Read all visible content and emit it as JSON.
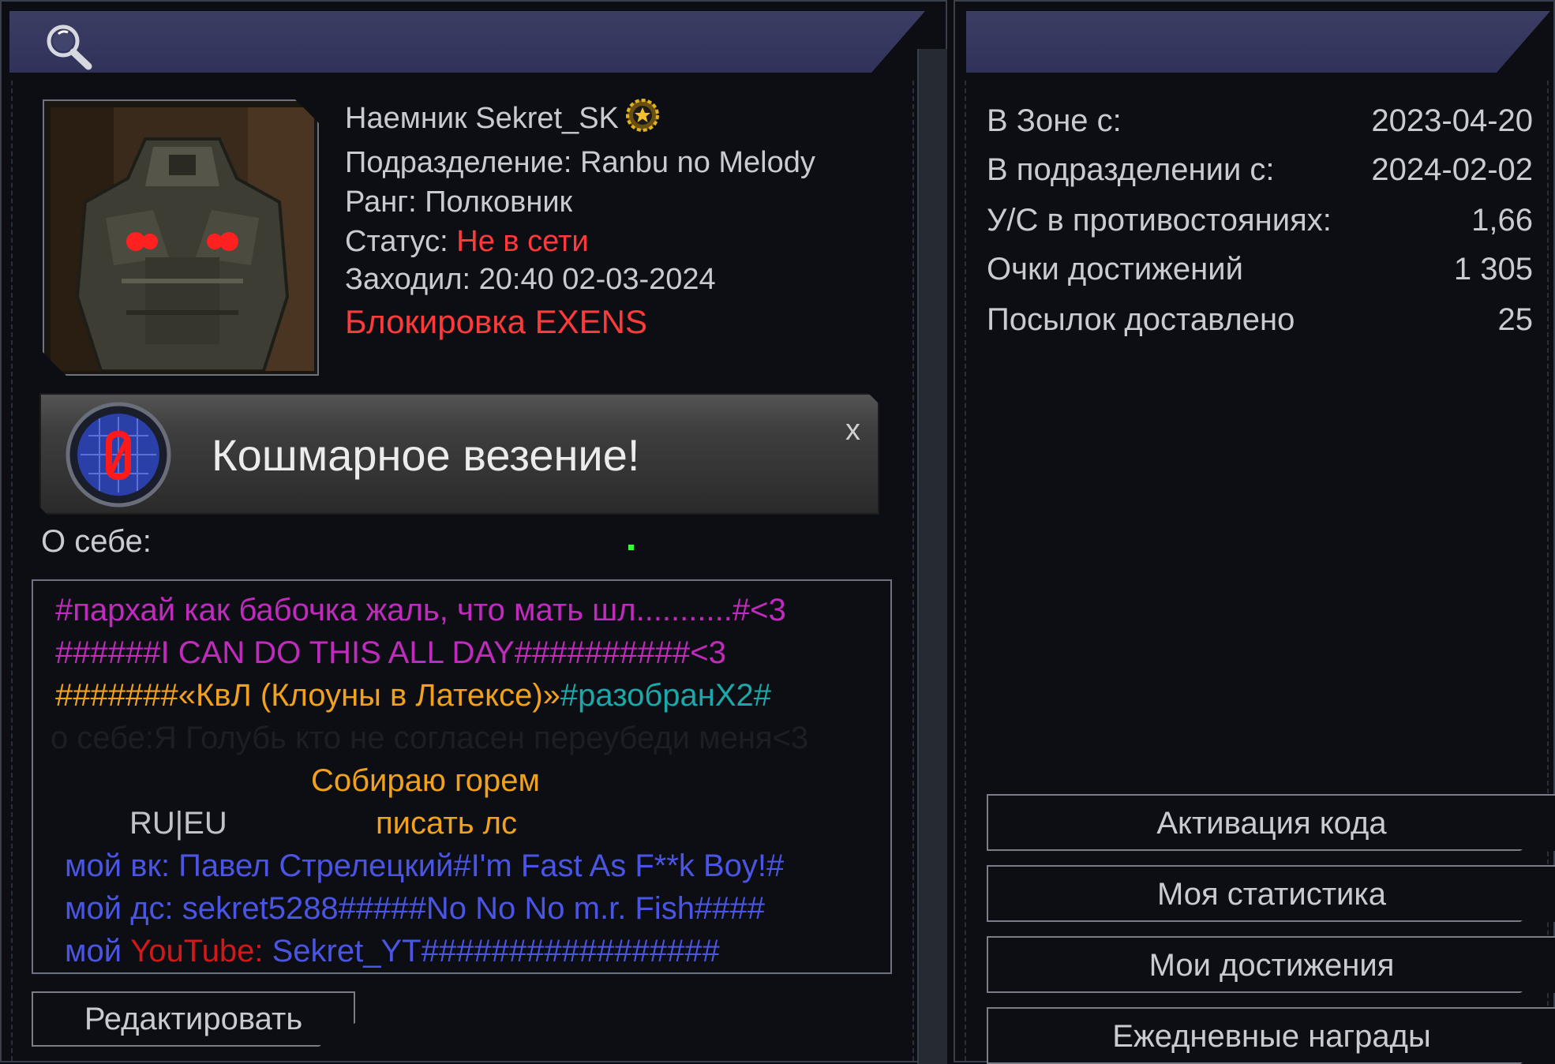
{
  "profile": {
    "name_line": "Наемник Sekret_SK",
    "division_label": "Подразделение:",
    "division_value": "Ranbu no Melody",
    "rank_label": "Ранг:",
    "rank_value": "Полковник",
    "status_label": "Статус:",
    "status_value": "Не в сети",
    "last_seen_label": "Заходил:",
    "last_seen_value": "20:40 02-03-2024",
    "block_text": "Блокировка EXENS"
  },
  "achievement": {
    "title": "Кошмарное везение!",
    "close": "x"
  },
  "about": {
    "label": "О себе:",
    "lines": [
      "#пархай как бабочка жаль, что мать шл...........#<3",
      "######I CAN DO THIS ALL DAY##########<3",
      "#######«КвЛ (Клоуны в Латексе)»",
      "#разобранX2#",
      "о себе:Я Голубь кто не согласен переубеди меня<3",
      "Собираю горем",
      "RU|EU",
      "писать лс",
      "мой вк: Павел Стрелецкий#I'm Fast As F**k Boy!#",
      "мой дс: sekret5288#####No No No m.r. Fish####",
      "мой ",
      "YouTube:",
      " Sekret_YT#################"
    ]
  },
  "buttons": {
    "edit": "Редактировать",
    "activate_code": "Активация кода",
    "my_stats": "Моя статистика",
    "my_achievements": "Мои достижения",
    "daily_rewards": "Ежедневные награды"
  },
  "stats": [
    {
      "label": "В Зоне с:",
      "value": "2023-04-20"
    },
    {
      "label": "В подразделении с:",
      "value": "2024-02-02"
    },
    {
      "label": "У/С в противостояниях:",
      "value": "1,66"
    },
    {
      "label": "Очки достижений",
      "value": "1 305"
    },
    {
      "label": "Посылок доставлено",
      "value": "25"
    }
  ],
  "colors": {
    "header": "#35375e",
    "pink": "#c02bbd",
    "orange": "#f2a21a",
    "teal": "#1aa8a8",
    "blue": "#4a55e4",
    "red": "#ff3a3a"
  }
}
